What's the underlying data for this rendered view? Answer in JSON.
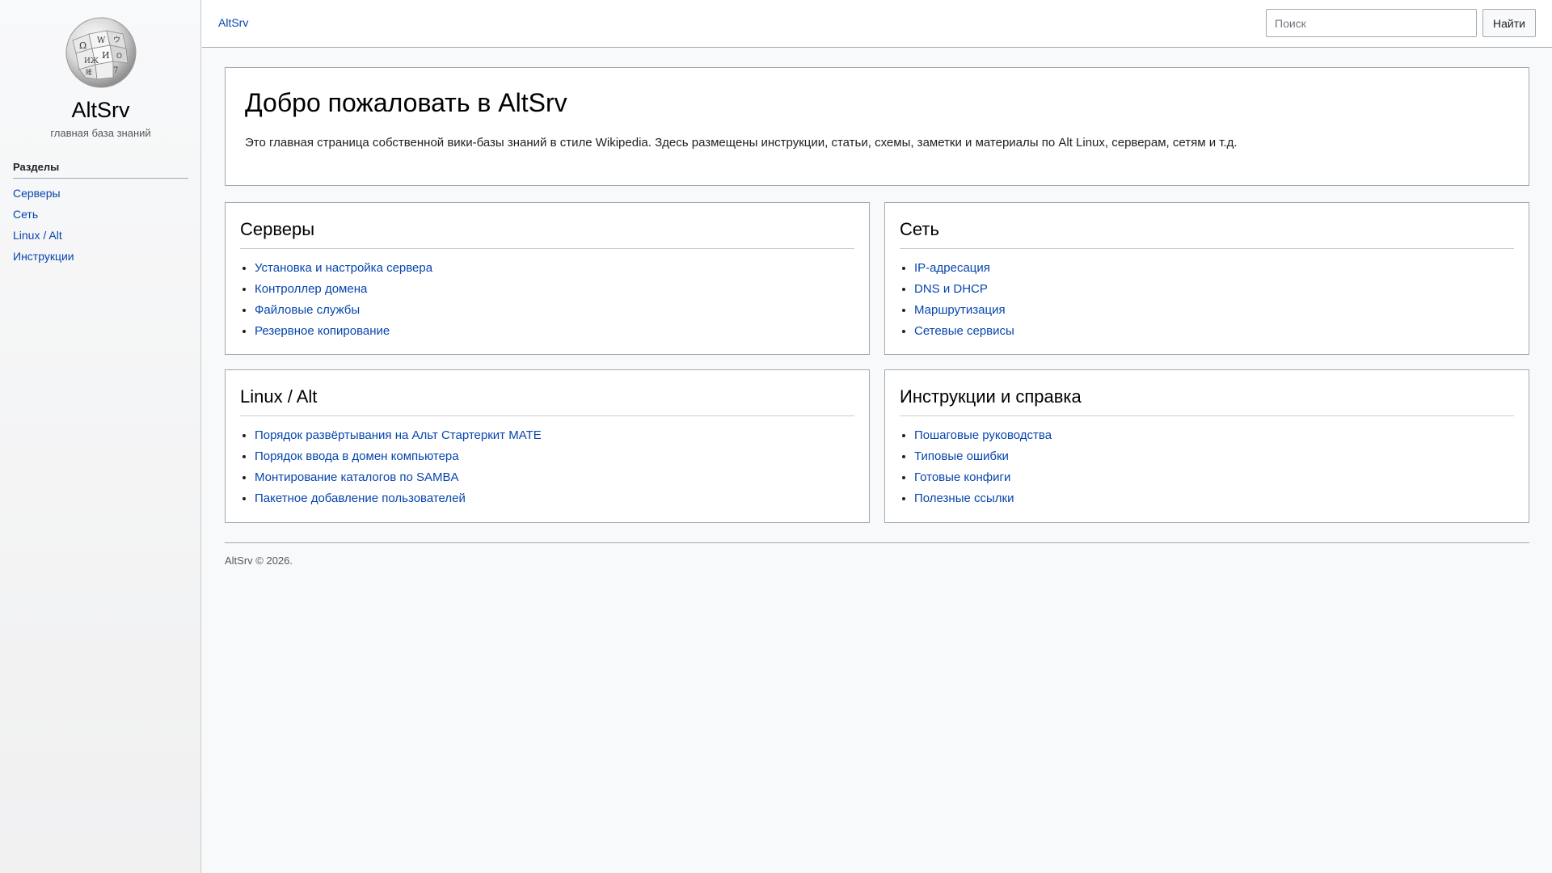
{
  "sidebar": {
    "logo_icon": "wikipedia-globe-icon",
    "site_name": "AltSrv",
    "tagline": "главная база знаний",
    "heading": "Разделы",
    "items": [
      {
        "label": "Серверы"
      },
      {
        "label": "Сеть"
      },
      {
        "label": "Linux / Alt"
      },
      {
        "label": "Инструкции"
      }
    ]
  },
  "header": {
    "site_link": "AltSrv",
    "search_placeholder": "Поиск",
    "search_button": "Найти"
  },
  "welcome": {
    "title": "Добро пожаловать в AltSrv",
    "text": "Это главная страница собственной вики-базы знаний в стиле Wikipedia. Здесь размещены инструкции, статьи, схемы, заметки и материалы по Alt Linux, серверам, сетям и т.д."
  },
  "panels": [
    {
      "title": "Серверы",
      "links": [
        "Установка и настройка сервера",
        "Контроллер домена",
        "Файловые службы",
        "Резервное копирование"
      ]
    },
    {
      "title": "Сеть",
      "links": [
        "IP-адресация",
        "DNS и DHCP",
        "Маршрутизация",
        "Сетевые сервисы"
      ]
    },
    {
      "title": "Linux / Alt",
      "links": [
        "Порядок развёртывания на Альт Стартеркит MATE",
        "Порядок ввода в домен компьютера",
        "Монтирование каталогов по SAMBA",
        "Пакетное добавление пользователей"
      ]
    },
    {
      "title": "Инструкции и справка",
      "links": [
        "Пошаговые руководства",
        "Типовые ошибки",
        "Готовые конфиги",
        "Полезные ссылки"
      ]
    }
  ],
  "footer": {
    "text": "AltSrv © 2026."
  },
  "colors": {
    "link": "#0645ad",
    "border": "#a2a9b1",
    "background": "#f8f9fa"
  }
}
